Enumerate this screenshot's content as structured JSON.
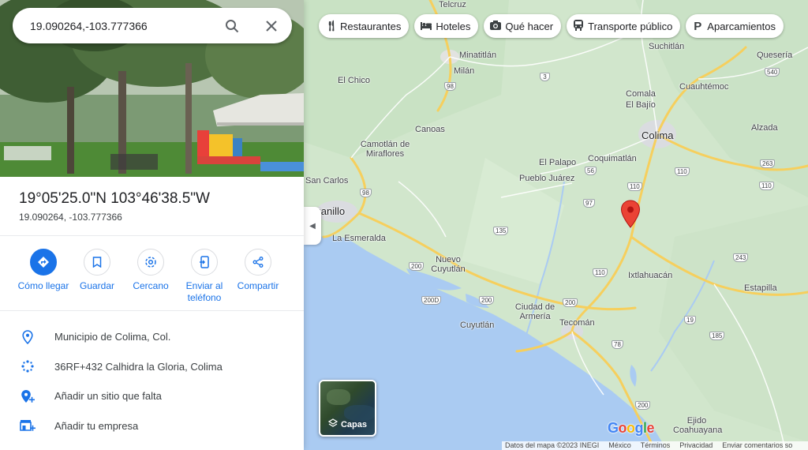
{
  "search": {
    "value": "19.090264,-103.777366"
  },
  "place": {
    "dms": "19°05'25.0\"N 103°46'38.5\"W",
    "decimal": "19.090264, -103.777366"
  },
  "actions": [
    {
      "label": "Cómo llegar",
      "icon": "directions-icon"
    },
    {
      "label": "Guardar",
      "icon": "bookmark-icon"
    },
    {
      "label": "Cercano",
      "icon": "nearby-icon"
    },
    {
      "label": "Enviar al teléfono",
      "icon": "send-to-phone-icon"
    },
    {
      "label": "Compartir",
      "icon": "share-icon"
    }
  ],
  "info": [
    {
      "text": "Municipio de Colima, Col.",
      "icon": "location-pin-icon"
    },
    {
      "text": "36RF+432 Calhidra la Gloria, Colima",
      "icon": "plus-code-icon"
    },
    {
      "text": "Añadir un sitio que falta",
      "icon": "add-place-icon"
    },
    {
      "text": "Añadir tu empresa",
      "icon": "add-business-icon"
    }
  ],
  "chips": [
    {
      "label": "Restaurantes",
      "icon": "restaurant-icon"
    },
    {
      "label": "Hoteles",
      "icon": "hotel-icon"
    },
    {
      "label": "Qué hacer",
      "icon": "camera-icon"
    },
    {
      "label": "Transporte público",
      "icon": "transit-icon"
    },
    {
      "label": "Aparcamientos",
      "icon": "parking-icon"
    }
  ],
  "map": {
    "places": {
      "telcruz": "Telcruz",
      "minatitlan": "Minatitlán",
      "milan": "Milán",
      "elchico": "El Chico",
      "suchitlan": "Suchitlán",
      "queseria": "Quesería",
      "cuauhtemoc": "Cuauhtémoc",
      "comala": "Comala",
      "elbajio": "El Bajío",
      "colima": "Colima",
      "alzada": "Alzada",
      "canoas": "Canoas",
      "camotlan": "Camotlán de Miraflores",
      "elpalapo": "El Palapo",
      "coquimatlan": "Coquimatlán",
      "pueblojuarez": "Pueblo Juárez",
      "sancarlos": "San Carlos",
      "manzanillo": "nzanillo",
      "esmeralda": "La Esmeralda",
      "nuevocuyutlan": "Nuevo Cuyutlán",
      "ixtlahuacan": "Ixtlahuacán",
      "estapilla": "Estapilla",
      "cuyutlan": "Cuyutlán",
      "armeria": "Ciudad de Armería",
      "tecoman": "Tecomán",
      "ejido": "Ejido Coahuayana"
    },
    "shields": {
      "s98a": "98",
      "s3": "3",
      "s540": "540",
      "s110a": "110",
      "s263": "263",
      "s56": "56",
      "s110b": "110",
      "s110c": "110",
      "s98b": "98",
      "s97": "97",
      "s135": "135",
      "s200a": "200",
      "s110d": "110",
      "s243": "243",
      "s200b": "200D",
      "s200c": "200",
      "s200d": "200",
      "s19": "19",
      "s185": "185",
      "s78": "78",
      "s200e": "200"
    },
    "layers_label": "Capas",
    "google_letters": [
      "G",
      "o",
      "o",
      "g",
      "l",
      "e"
    ],
    "attribution": [
      "Datos del mapa ©2023 INEGI",
      "México",
      "Términos",
      "Privacidad",
      "Enviar comentarios so"
    ],
    "pin_color": "#ea4335",
    "water_color": "#aacbf2",
    "land_color": "#d4e8d0",
    "road_color": "#f9d76e"
  }
}
